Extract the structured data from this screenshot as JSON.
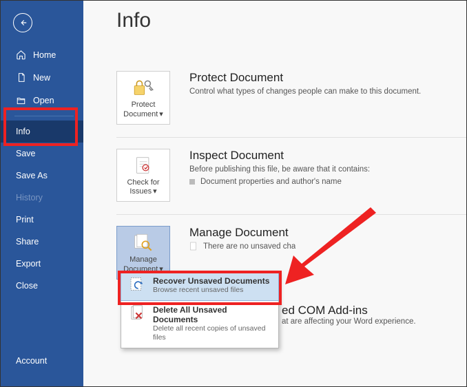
{
  "page_title": "Info",
  "sidebar": {
    "items": [
      {
        "label": "Home",
        "icon": "home-icon"
      },
      {
        "label": "New",
        "icon": "new-icon"
      },
      {
        "label": "Open",
        "icon": "open-icon"
      }
    ],
    "core": [
      {
        "label": "Info",
        "selected": true
      },
      {
        "label": "Save"
      },
      {
        "label": "Save As"
      },
      {
        "label": "History",
        "disabled": true
      },
      {
        "label": "Print"
      },
      {
        "label": "Share"
      },
      {
        "label": "Export"
      },
      {
        "label": "Close"
      }
    ],
    "account_label": "Account"
  },
  "sections": {
    "protect": {
      "button_label": "Protect Document",
      "heading": "Protect Document",
      "desc": "Control what types of changes people can make to this document."
    },
    "inspect": {
      "button_label": "Check for Issues",
      "heading": "Inspect Document",
      "desc_intro": "Before publishing this file, be aware that it contains:",
      "bullet1": "Document properties and author's name"
    },
    "manage": {
      "button_label": "Manage Document",
      "heading": "Manage Document",
      "no_unsaved": "There are no unsaved cha"
    },
    "com_addins": {
      "heading_partial": "ed COM Add-ins",
      "desc_partial": "at are affecting your Word experience."
    }
  },
  "dropdown": {
    "recover": {
      "title": "Recover Unsaved Documents",
      "sub": "Browse recent unsaved files"
    },
    "delete": {
      "title": "Delete All Unsaved Documents",
      "sub": "Delete all recent copies of unsaved files"
    }
  }
}
